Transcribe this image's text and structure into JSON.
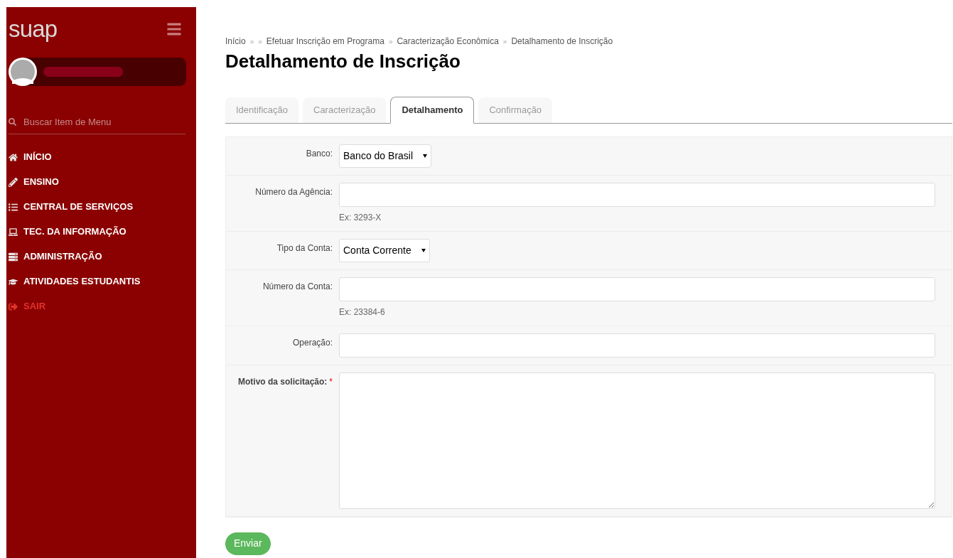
{
  "sidebar": {
    "logo": "suap",
    "search": {
      "placeholder": "Buscar Item de Menu"
    },
    "menu": [
      {
        "label": "INÍCIO",
        "kind": "link"
      },
      {
        "label": "ENSINO",
        "kind": "link"
      },
      {
        "label": "CENTRAL DE SERVIÇOS",
        "kind": "link"
      },
      {
        "label": "TEC. DA INFORMAÇÃO",
        "kind": "link"
      },
      {
        "label": "ADMINISTRAÇÃO",
        "kind": "link"
      },
      {
        "label": "ATIVIDADES ESTUDANTIS",
        "kind": "link"
      },
      {
        "label": "SAIR",
        "kind": "exit"
      }
    ]
  },
  "breadcrumb": [
    {
      "text": "Início",
      "kind": "link"
    },
    {
      "text": "»",
      "kind": "separator"
    },
    {
      "text": "»",
      "kind": "separator"
    },
    {
      "text": "Efetuar Inscrição em Programa",
      "kind": "link"
    },
    {
      "text": "»",
      "kind": "separator"
    },
    {
      "text": "Caracterização Econômica",
      "kind": "link"
    },
    {
      "text": "»",
      "kind": "separator"
    },
    {
      "text": "Detalhamento de Inscrição",
      "kind": "current"
    }
  ],
  "title": "Detalhamento de Inscrição",
  "tabs": [
    {
      "label": "Identificação",
      "selected": false
    },
    {
      "label": "Caracterização",
      "selected": false
    },
    {
      "label": "Detalhamento",
      "selected": true
    },
    {
      "label": "Confirmação",
      "selected": false
    }
  ],
  "form": [
    {
      "label": "Banco:",
      "kind": "select",
      "value": "Banco do Brasil",
      "required": false
    },
    {
      "label": "Número da Agência:",
      "kind": "text",
      "help": "Ex: 3293-X",
      "required": false
    },
    {
      "label": "Tipo da Conta:",
      "kind": "select",
      "value": "Conta Corrente",
      "required": false
    },
    {
      "label": "Número da Conta:",
      "kind": "text",
      "help": "Ex: 23384-6",
      "required": false
    },
    {
      "label": "Operação:",
      "kind": "text",
      "required": false
    },
    {
      "label": "Motivo da solicitação:",
      "kind": "textarea",
      "required": true,
      "mark": "*"
    }
  ],
  "submit": "Enviar"
}
